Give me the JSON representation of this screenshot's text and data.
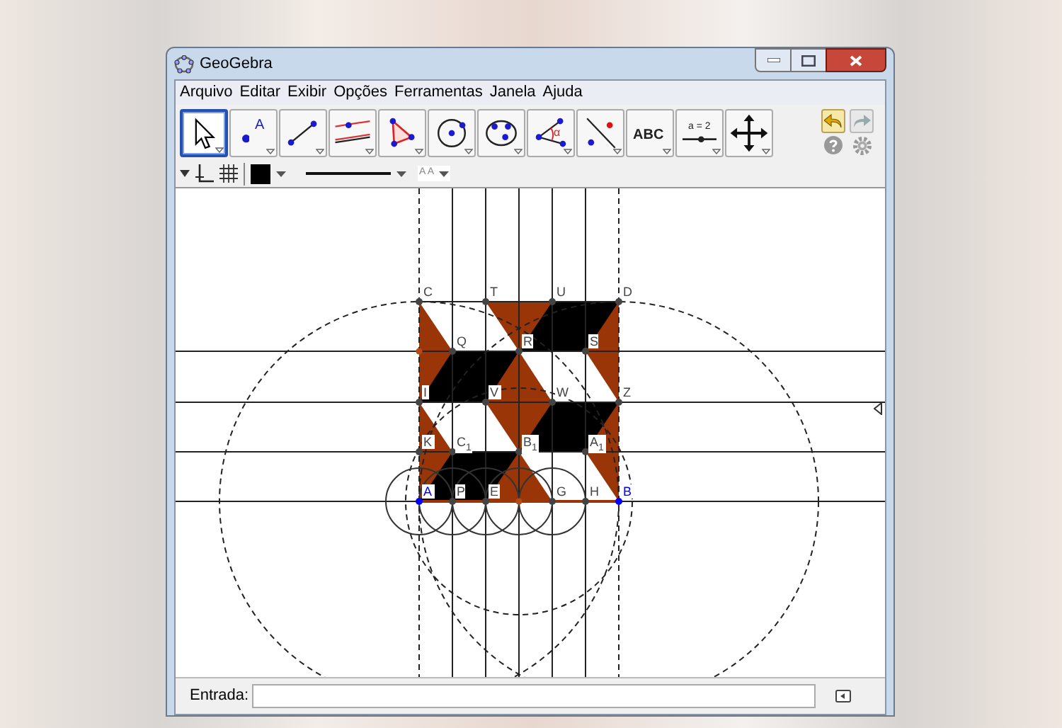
{
  "window": {
    "title": "GeoGebra"
  },
  "menu": [
    "Arquivo",
    "Editar",
    "Exibir",
    "Opções",
    "Ferramentas",
    "Janela",
    "Ajuda"
  ],
  "toolbar": [
    {
      "kind": "pointer",
      "selected": true
    },
    {
      "kind": "point",
      "selected": false,
      "text": "A"
    },
    {
      "kind": "segment",
      "selected": false
    },
    {
      "kind": "parallel",
      "selected": false
    },
    {
      "kind": "polygon",
      "selected": false
    },
    {
      "kind": "circle",
      "selected": false
    },
    {
      "kind": "conic",
      "selected": false
    },
    {
      "kind": "angle",
      "selected": false,
      "text": "α"
    },
    {
      "kind": "reflect",
      "selected": false
    },
    {
      "kind": "label",
      "selected": false,
      "text": "ABC"
    },
    {
      "kind": "slider",
      "selected": false,
      "text": "a = 2"
    },
    {
      "kind": "move",
      "selected": false
    }
  ],
  "style_bar": {
    "font_size_label": "A A"
  },
  "points": [
    {
      "label": "C",
      "color": "#444444"
    },
    {
      "label": "T",
      "color": "#444444"
    },
    {
      "label": "U",
      "color": "#444444"
    },
    {
      "label": "D",
      "color": "#444444"
    },
    {
      "label": "Q",
      "color": "#444444"
    },
    {
      "label": "R",
      "color": "#444444"
    },
    {
      "label": "S",
      "color": "#444444"
    },
    {
      "label": "I",
      "color": "#444444"
    },
    {
      "label": "V",
      "color": "#444444"
    },
    {
      "label": "W",
      "color": "#444444"
    },
    {
      "label": "Z",
      "color": "#444444"
    },
    {
      "label": "K",
      "color": "#444444"
    },
    {
      "label": "C$_{1}$",
      "color": "#444444"
    },
    {
      "label": "B$_{1}$",
      "color": "#444444"
    },
    {
      "label": "A$_{1}$",
      "color": "#444444"
    },
    {
      "label": "A",
      "color": "#0000ff"
    },
    {
      "label": "P",
      "color": "#444444"
    },
    {
      "label": "E",
      "color": "#444444"
    },
    {
      "label": "G",
      "color": "#444444"
    },
    {
      "label": "H",
      "color": "#444444"
    },
    {
      "label": "B",
      "color": "#0000ff"
    }
  ],
  "input_bar": {
    "label": "Entrada:"
  }
}
